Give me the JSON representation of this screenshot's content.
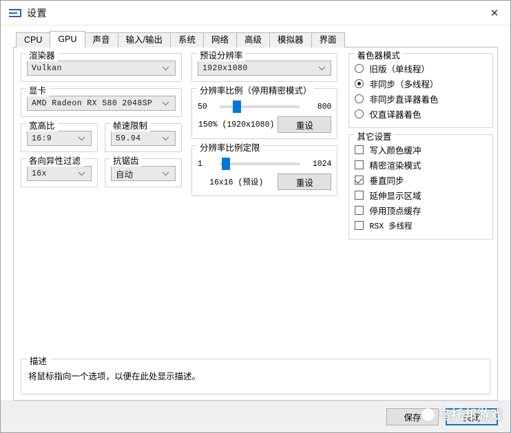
{
  "window": {
    "title": "设置",
    "icon": "menu-icon",
    "close_label": "✕",
    "accent": "#0078d7"
  },
  "tabs": [
    {
      "label": "CPU",
      "active": false
    },
    {
      "label": "GPU",
      "active": true
    },
    {
      "label": "声音",
      "active": false
    },
    {
      "label": "输入/输出",
      "active": false
    },
    {
      "label": "系统",
      "active": false
    },
    {
      "label": "网络",
      "active": false
    },
    {
      "label": "高级",
      "active": false
    },
    {
      "label": "模拟器",
      "active": false
    },
    {
      "label": "界面",
      "active": false
    }
  ],
  "left": {
    "renderer": {
      "title": "渲染器",
      "value": "Vulkan"
    },
    "gpu": {
      "title": "显卡",
      "value": "AMD Radeon RX 580 2048SP"
    },
    "aspect": {
      "title": "宽高比",
      "value": "16:9"
    },
    "framelimit": {
      "title": "帧速限制",
      "value": "59.94"
    },
    "anisotropic": {
      "title": "各向异性过滤",
      "value": "16x"
    },
    "antialias": {
      "title": "抗锯齿",
      "value": "自动"
    }
  },
  "middle": {
    "preset": {
      "title": "预设分辨率",
      "value": "1920x1080"
    },
    "res_scale": {
      "title": "分辨率比例（停用精密模式）",
      "min": "50",
      "max": "800",
      "value_label": "150% (1920x1080)",
      "reset_label": "重设",
      "percent": 16
    },
    "res_scale_threshold": {
      "title": "分辨率比例定限",
      "min": "1",
      "max": "1024",
      "value_label": "16x16 (预设)",
      "reset_label": "重设",
      "percent": 3
    }
  },
  "right": {
    "shader_mode": {
      "title": "着色器模式",
      "options": [
        {
          "label": "旧版（单线程）",
          "selected": false
        },
        {
          "label": "非同步（多线程）",
          "selected": true
        },
        {
          "label": "非同步直译器着色",
          "selected": false
        },
        {
          "label": "仅直译器着色",
          "selected": false
        }
      ]
    },
    "other_settings": {
      "title": "其它设置",
      "options": [
        {
          "label": "写入颜色缓冲",
          "checked": false,
          "mono": false
        },
        {
          "label": "精密渲染模式",
          "checked": false,
          "mono": false
        },
        {
          "label": "垂直同步",
          "checked": true,
          "mono": false
        },
        {
          "label": "延伸显示区域",
          "checked": false,
          "mono": false
        },
        {
          "label": "停用顶点缓存",
          "checked": false,
          "mono": false
        },
        {
          "label": "RSX 多线程",
          "checked": false,
          "mono": true
        }
      ]
    }
  },
  "description": {
    "title": "描述",
    "text": "将鼠标指向一个选项，以便在此处显示描述。"
  },
  "footer": {
    "save_label": "保存",
    "close_label": "关闭",
    "watermark": "乌托邦游戏"
  }
}
